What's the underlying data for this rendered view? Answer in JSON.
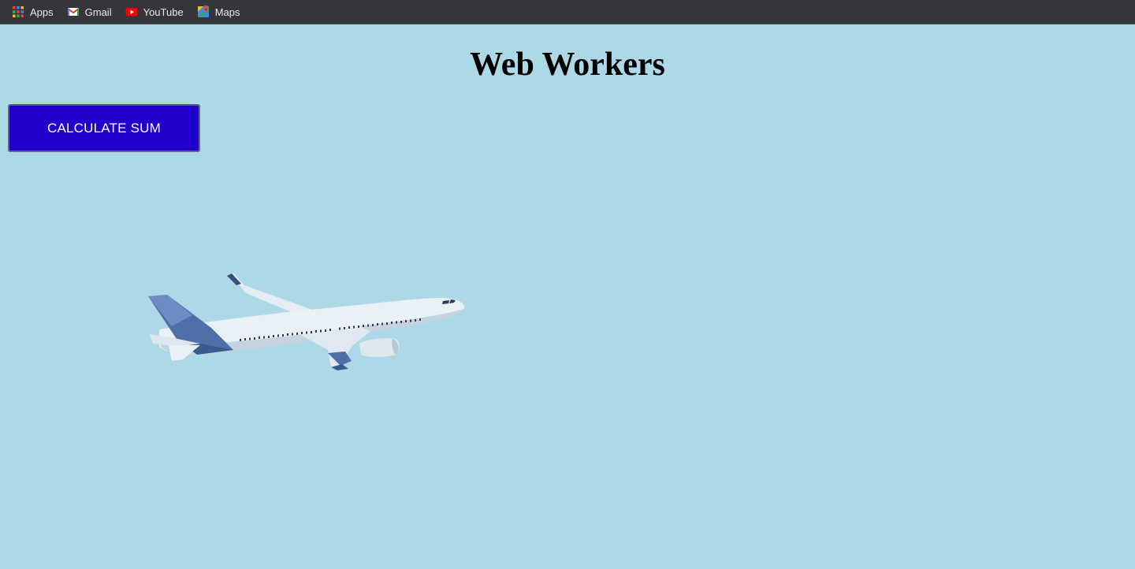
{
  "bookmarks": [
    {
      "label": "Apps",
      "icon": "apps-grid-icon"
    },
    {
      "label": "Gmail",
      "icon": "gmail-icon"
    },
    {
      "label": "YouTube",
      "icon": "youtube-icon"
    },
    {
      "label": "Maps",
      "icon": "maps-icon"
    }
  ],
  "page": {
    "title": "Web Workers",
    "button_label": "CALCULATE SUM",
    "background_color": "#add8e6",
    "button_color": "#2200cc"
  },
  "image": {
    "icon": "airplane-image"
  }
}
